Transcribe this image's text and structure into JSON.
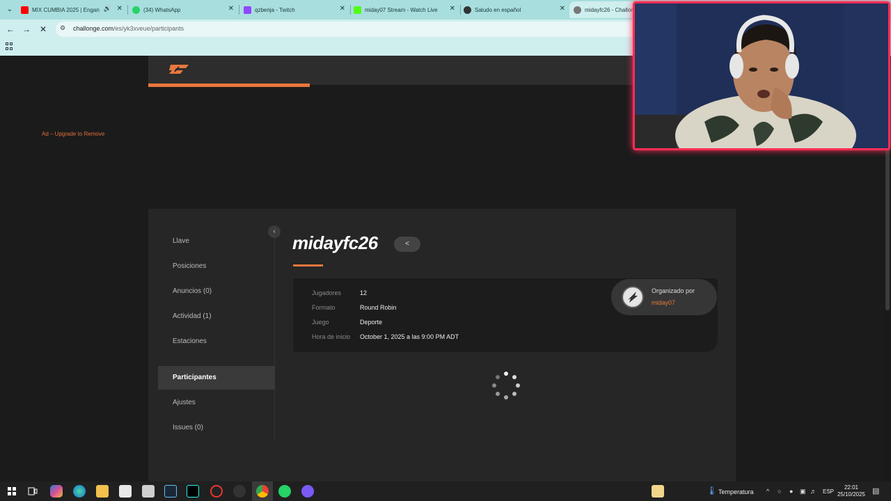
{
  "browser": {
    "tabs": [
      {
        "title": "MIX CUMBIA 2025 | Engan",
        "favicon_color": "#ff0000"
      },
      {
        "title": "(34) WhatsApp",
        "favicon_color": "#25d366"
      },
      {
        "title": "qzbenja - Twitch",
        "favicon_color": "#9146ff"
      },
      {
        "title": "miday07 Stream - Watch Live",
        "favicon_color": "#53fc18"
      },
      {
        "title": "Saludo en español",
        "favicon_color": "#333333"
      },
      {
        "title": "midayfc26 - Challon",
        "favicon_color": "#777777"
      }
    ],
    "url_host": "challonge.com",
    "url_path": "/es/yk3xveue/participants"
  },
  "page": {
    "ad_text": "Ad – Upgrade to Remove",
    "brand_color": "#e8773d",
    "nav": [
      {
        "label": "Llave"
      },
      {
        "label": "Posiciones"
      },
      {
        "label": "Anuncios (0)"
      },
      {
        "label": "Actividad (1)"
      },
      {
        "label": "Estaciones"
      },
      {
        "label": "Participantes",
        "active": true
      },
      {
        "label": "Ajustes"
      },
      {
        "label": "Issues (0)"
      }
    ],
    "tournament_title": "midayfc26",
    "info": [
      {
        "key": "Jugadores",
        "value": "12"
      },
      {
        "key": "Formato",
        "value": "Round Robin"
      },
      {
        "key": "Juego",
        "value": "Deporte"
      },
      {
        "key": "Hora de inicio",
        "value": "October 1, 2025 a las 9:00 PM ADT"
      }
    ],
    "organizer_label": "Organizado por",
    "organizer_name": "miday07"
  },
  "taskbar": {
    "weather_label": "Temperatura",
    "language": "ESP",
    "time": "22:01",
    "date": "25/10/2025"
  }
}
